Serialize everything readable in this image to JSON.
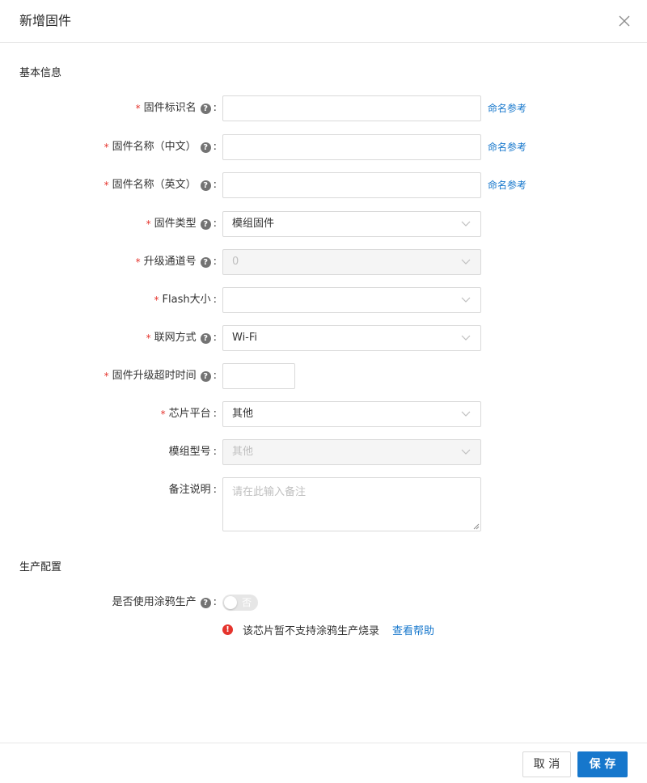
{
  "dialog": {
    "title": "新增固件",
    "close_icon": "close-icon"
  },
  "sections": {
    "basic": "基本信息",
    "production": "生产配置"
  },
  "form": {
    "firmware_key": {
      "label": "固件标识名",
      "required": true,
      "value": "",
      "link": "命名参考"
    },
    "name_cn": {
      "label": "固件名称（中文）",
      "required": true,
      "value": "",
      "link": "命名参考"
    },
    "name_en": {
      "label": "固件名称（英文）",
      "required": true,
      "value": "",
      "link": "命名参考"
    },
    "firmware_type": {
      "label": "固件类型",
      "required": true,
      "value": "模组固件"
    },
    "upgrade_channel": {
      "label": "升级通道号",
      "required": true,
      "value": "0",
      "disabled": true
    },
    "flash_size": {
      "label": "Flash大小",
      "required": true,
      "value": ""
    },
    "network_mode": {
      "label": "联网方式",
      "required": true,
      "value": "Wi-Fi"
    },
    "upgrade_timeout": {
      "label": "固件升级超时时间",
      "required": true,
      "value": ""
    },
    "chip_platform": {
      "label": "芯片平台",
      "required": true,
      "value": "其他"
    },
    "module_model": {
      "label": "模组型号",
      "required": false,
      "value": "其他",
      "disabled": true
    },
    "remark": {
      "label": "备注说明",
      "required": false,
      "placeholder": "请在此输入备注"
    },
    "graffiti_production": {
      "label": "是否使用涂鸦生产",
      "required": false,
      "switch_text": "否",
      "on": false
    }
  },
  "notice": {
    "message": "该芯片暂不支持涂鸦生产烧录",
    "link": "查看帮助"
  },
  "footer": {
    "cancel_label": "取 消",
    "save_label": "保 存"
  },
  "glyphs": {
    "required": "*",
    "help": "?",
    "colon": ":",
    "error": "!"
  },
  "colors": {
    "primary": "#1677cc",
    "required": "#e5342d",
    "error": "#e5342d"
  }
}
